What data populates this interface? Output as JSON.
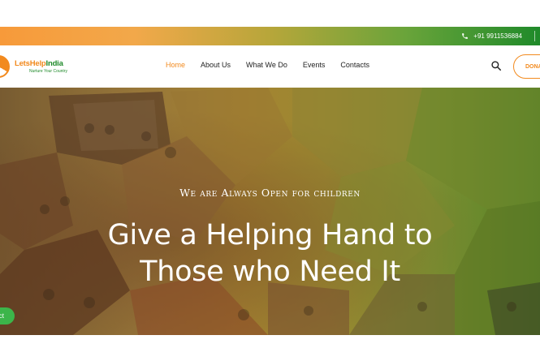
{
  "topbar": {
    "phone": "+91 9911536884",
    "phone_icon": "phone-icon"
  },
  "brand": {
    "name_part1": "LetsHelp",
    "name_part2": "India",
    "tagline": "Nurture Your Country"
  },
  "nav": {
    "items": [
      {
        "label": "Home",
        "active": true
      },
      {
        "label": "About Us",
        "active": false
      },
      {
        "label": "What We Do",
        "active": false
      },
      {
        "label": "Events",
        "active": false
      },
      {
        "label": "Contacts",
        "active": false
      }
    ],
    "donate_label": "DONA"
  },
  "hero": {
    "tagline": "We are Always Open for children",
    "headline_line1": "Give a Helping Hand to",
    "headline_line2": "Those who Need It",
    "contact_label": "ct"
  },
  "colors": {
    "accent_orange": "#f28a1e",
    "accent_green": "#1f8a2a",
    "button_green": "#3cb54a"
  }
}
